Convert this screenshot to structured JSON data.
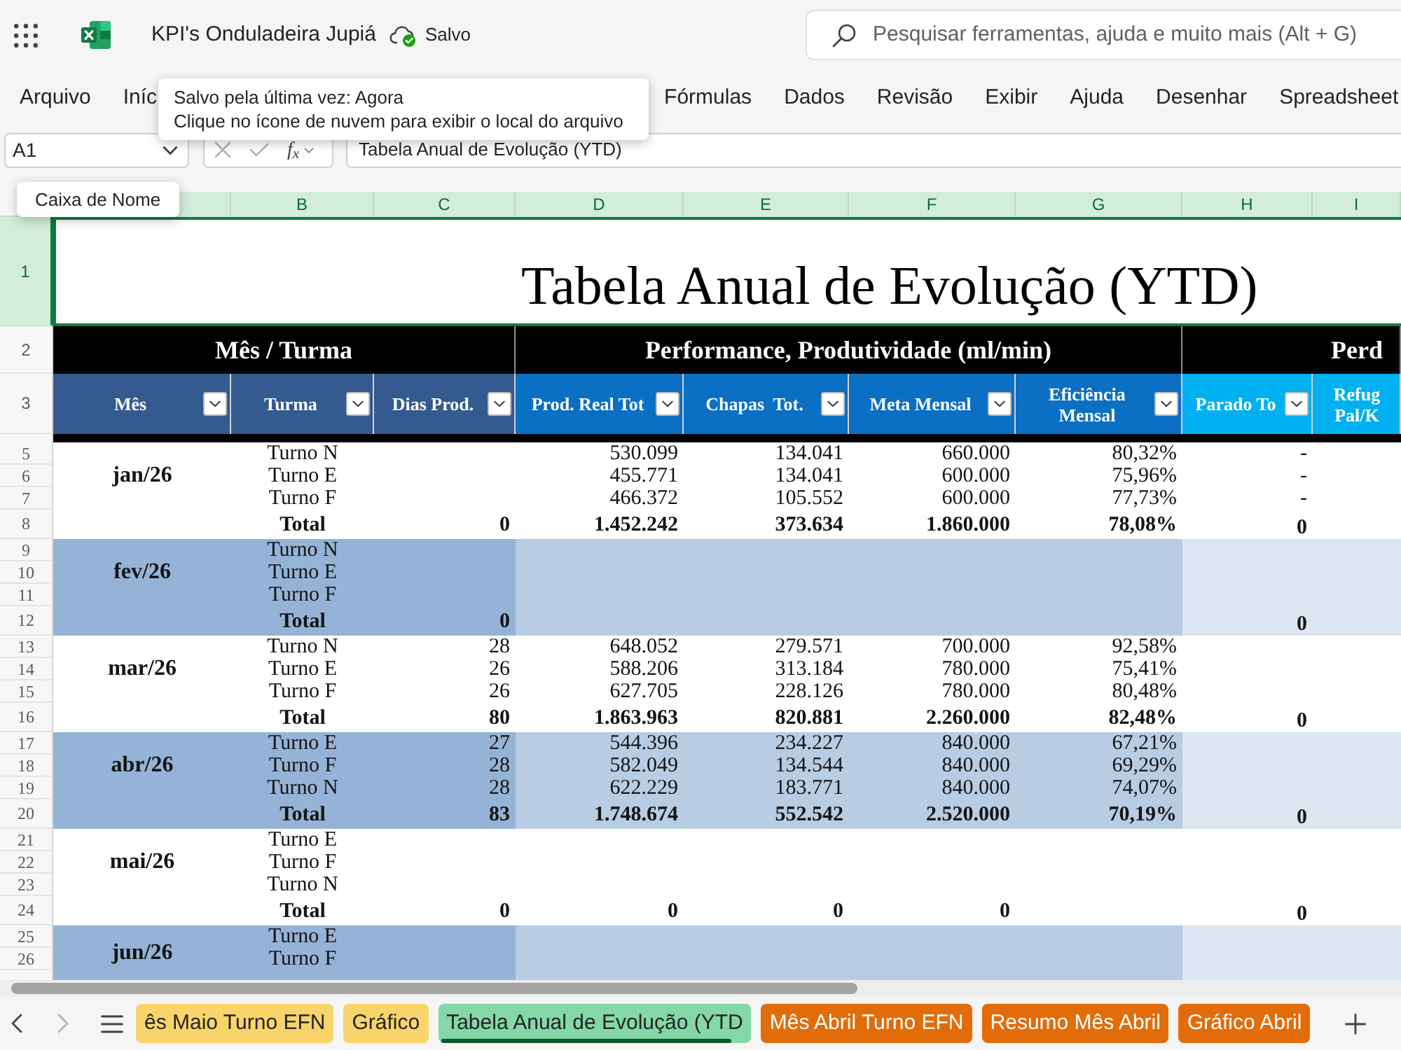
{
  "app_bar": {
    "title": "KPI's Onduladeira Jupiá",
    "save_status": "Salvo",
    "search": {
      "placeholder": "Pesquisar ferramentas, ajuda e muito mais (Alt + G)"
    }
  },
  "save_tooltip": [
    "Salvo pela última vez: Agora",
    "Clique no ícone de nuvem para exibir o local do arquivo"
  ],
  "menu": [
    "Arquivo",
    "Iníc",
    "Fórmulas",
    "Dados",
    "Revisão",
    "Exibir",
    "Ajuda",
    "Desenhar",
    "Spreadsheet"
  ],
  "formula_bar": {
    "name_box": "A1",
    "cancel_disabled": true,
    "enter_disabled": true,
    "function_label": "f$_{x}$",
    "formula": "Tabela Anual de Evolução (YTD)"
  },
  "name_box_tooltip": "Caixa de Nome",
  "sheet": {
    "column_headers": [
      {
        "selected": true
      },
      {
        "label": "B",
        "selected": true
      },
      {
        "label": "C",
        "selected": true
      },
      {
        "label": "D",
        "selected": true
      },
      {
        "label": "E",
        "selected": true
      },
      {
        "label": "F",
        "selected": true
      },
      {
        "label": "G",
        "selected": true
      },
      {
        "label": "H",
        "selected": true
      },
      {
        "label": "I",
        "selected": true
      }
    ],
    "title_row": {
      "row": "1",
      "selected": true,
      "text": "Tabela Anual de Evolução (YTD)"
    },
    "group_row": {
      "row": "2",
      "selected": false,
      "groups": [
        "Mês / Turma",
        "Performance, Produtividade (ml/min)",
        "Perd"
      ]
    },
    "header_row": {
      "row": "3",
      "selected": false,
      "columns": [
        {
          "label": "Mês",
          "color": "#345a8f",
          "filter": true
        },
        {
          "label": "Turma",
          "color": "#345a8f",
          "filter": true
        },
        {
          "label": "Dias Prod.",
          "color": "#345a8f",
          "filter": true
        },
        {
          "label": "Prod. Real Tot",
          "color": "#0b6fc4",
          "filter": true
        },
        {
          "label": "Chapas  Tot.",
          "color": "#0b6fc4",
          "filter": true
        },
        {
          "label": "Meta Mensal",
          "color": "#0b6fc4",
          "filter": true
        },
        {
          "label": "Eficiência Mensal",
          "color": "#0b6fc4",
          "filter": true
        },
        {
          "label": "Parado To",
          "color": "#00b0f0",
          "filter": true
        },
        {
          "label": "Refug Pal/K",
          "color": "#00b0f0",
          "filter": false
        }
      ]
    },
    "months": [
      {
        "label": "jan/26",
        "shaded": false,
        "rows": [
          {
            "row": "5",
            "selected": false,
            "kind": "shift",
            "turma": "Turno N",
            "prod_real_tot": "530.099",
            "chapas_tot": "134.041",
            "meta_mensal": "660.000",
            "eficiencia_mensal": "80,32%",
            "parado_tot": "-"
          },
          {
            "row": "6",
            "selected": false,
            "kind": "shift",
            "turma": "Turno E",
            "prod_real_tot": "455.771",
            "chapas_tot": "134.041",
            "meta_mensal": "600.000",
            "eficiencia_mensal": "75,96%",
            "parado_tot": "-"
          },
          {
            "row": "7",
            "selected": false,
            "kind": "shift",
            "turma": "Turno F",
            "prod_real_tot": "466.372",
            "chapas_tot": "105.552",
            "meta_mensal": "600.000",
            "eficiencia_mensal": "77,73%",
            "parado_tot": "-"
          },
          {
            "row": "8",
            "selected": false,
            "kind": "total",
            "turma": "Total",
            "dias_prod": "0",
            "prod_real_tot": "1.452.242",
            "chapas_tot": "373.634",
            "meta_mensal": "1.860.000",
            "eficiencia_mensal": "78,08%",
            "parado_tot": "0"
          }
        ]
      },
      {
        "label": "fev/26",
        "shaded": true,
        "rows": [
          {
            "row": "9",
            "selected": false,
            "kind": "shift",
            "turma": "Turno N"
          },
          {
            "row": "10",
            "selected": false,
            "kind": "shift",
            "turma": "Turno E"
          },
          {
            "row": "11",
            "selected": false,
            "kind": "shift",
            "turma": "Turno F"
          },
          {
            "row": "12",
            "selected": false,
            "kind": "total",
            "turma": "Total",
            "dias_prod": "0",
            "parado_tot": "0"
          }
        ]
      },
      {
        "label": "mar/26",
        "shaded": false,
        "rows": [
          {
            "row": "13",
            "selected": false,
            "kind": "shift",
            "turma": "Turno N",
            "dias_prod": "28",
            "prod_real_tot": "648.052",
            "chapas_tot": "279.571",
            "meta_mensal": "700.000",
            "eficiencia_mensal": "92,58%"
          },
          {
            "row": "14",
            "selected": false,
            "kind": "shift",
            "turma": "Turno E",
            "dias_prod": "26",
            "prod_real_tot": "588.206",
            "chapas_tot": "313.184",
            "meta_mensal": "780.000",
            "eficiencia_mensal": "75,41%"
          },
          {
            "row": "15",
            "selected": false,
            "kind": "shift",
            "turma": "Turno F",
            "dias_prod": "26",
            "prod_real_tot": "627.705",
            "chapas_tot": "228.126",
            "meta_mensal": "780.000",
            "eficiencia_mensal": "80,48%"
          },
          {
            "row": "16",
            "selected": false,
            "kind": "total",
            "turma": "Total",
            "dias_prod": "80",
            "prod_real_tot": "1.863.963",
            "chapas_tot": "820.881",
            "meta_mensal": "2.260.000",
            "eficiencia_mensal": "82,48%",
            "parado_tot": "0"
          }
        ]
      },
      {
        "label": "abr/26",
        "shaded": true,
        "rows": [
          {
            "row": "17",
            "selected": false,
            "kind": "shift",
            "turma": "Turno E",
            "dias_prod": "27",
            "prod_real_tot": "544.396",
            "chapas_tot": "234.227",
            "meta_mensal": "840.000",
            "eficiencia_mensal": "67,21%"
          },
          {
            "row": "18",
            "selected": false,
            "kind": "shift",
            "turma": "Turno F",
            "dias_prod": "28",
            "prod_real_tot": "582.049",
            "chapas_tot": "134.544",
            "meta_mensal": "840.000",
            "eficiencia_mensal": "69,29%"
          },
          {
            "row": "19",
            "selected": false,
            "kind": "shift",
            "turma": "Turno N",
            "dias_prod": "28",
            "prod_real_tot": "622.229",
            "chapas_tot": "183.771",
            "meta_mensal": "840.000",
            "eficiencia_mensal": "74,07%"
          },
          {
            "row": "20",
            "selected": false,
            "kind": "total",
            "turma": "Total",
            "dias_prod": "83",
            "prod_real_tot": "1.748.674",
            "chapas_tot": "552.542",
            "meta_mensal": "2.520.000",
            "eficiencia_mensal": "70,19%",
            "parado_tot": "0"
          }
        ]
      },
      {
        "label": "mai/26",
        "shaded": false,
        "rows": [
          {
            "row": "21",
            "selected": false,
            "kind": "shift",
            "turma": "Turno E"
          },
          {
            "row": "22",
            "selected": false,
            "kind": "shift",
            "turma": "Turno F"
          },
          {
            "row": "23",
            "selected": false,
            "kind": "shift",
            "turma": "Turno N"
          },
          {
            "row": "24",
            "selected": false,
            "kind": "total",
            "turma": "Total",
            "dias_prod": "0",
            "prod_real_tot": "0",
            "chapas_tot": "0",
            "meta_mensal": "0",
            "parado_tot": "0"
          }
        ]
      },
      {
        "label": "jun/26",
        "shaded": true,
        "rows": [
          {
            "row": "25",
            "selected": false,
            "kind": "shift",
            "turma": "Turno E"
          },
          {
            "row": "26",
            "selected": false,
            "kind": "shift",
            "turma": "Turno F"
          }
        ]
      }
    ]
  },
  "sheet_nav": {
    "previous_disabled": false,
    "next_disabled": true
  },
  "sheet_tabs": [
    {
      "label": "ês Maio Turno EFN",
      "color": "#f9d46a",
      "selected": false
    },
    {
      "label": "Gráfico",
      "color": "#f9d46a",
      "selected": false
    },
    {
      "label": "Tabela Anual de Evolução (YTD",
      "color": "#84d7a9",
      "selected": true
    },
    {
      "label": "Mês Abril Turno EFN",
      "color": "#e36c0a",
      "selected": false
    },
    {
      "label": "Resumo Mês Abril",
      "color": "#e36c0a",
      "selected": false
    },
    {
      "label": "Gráfico Abril",
      "color": "#e36c0a",
      "selected": false
    }
  ]
}
